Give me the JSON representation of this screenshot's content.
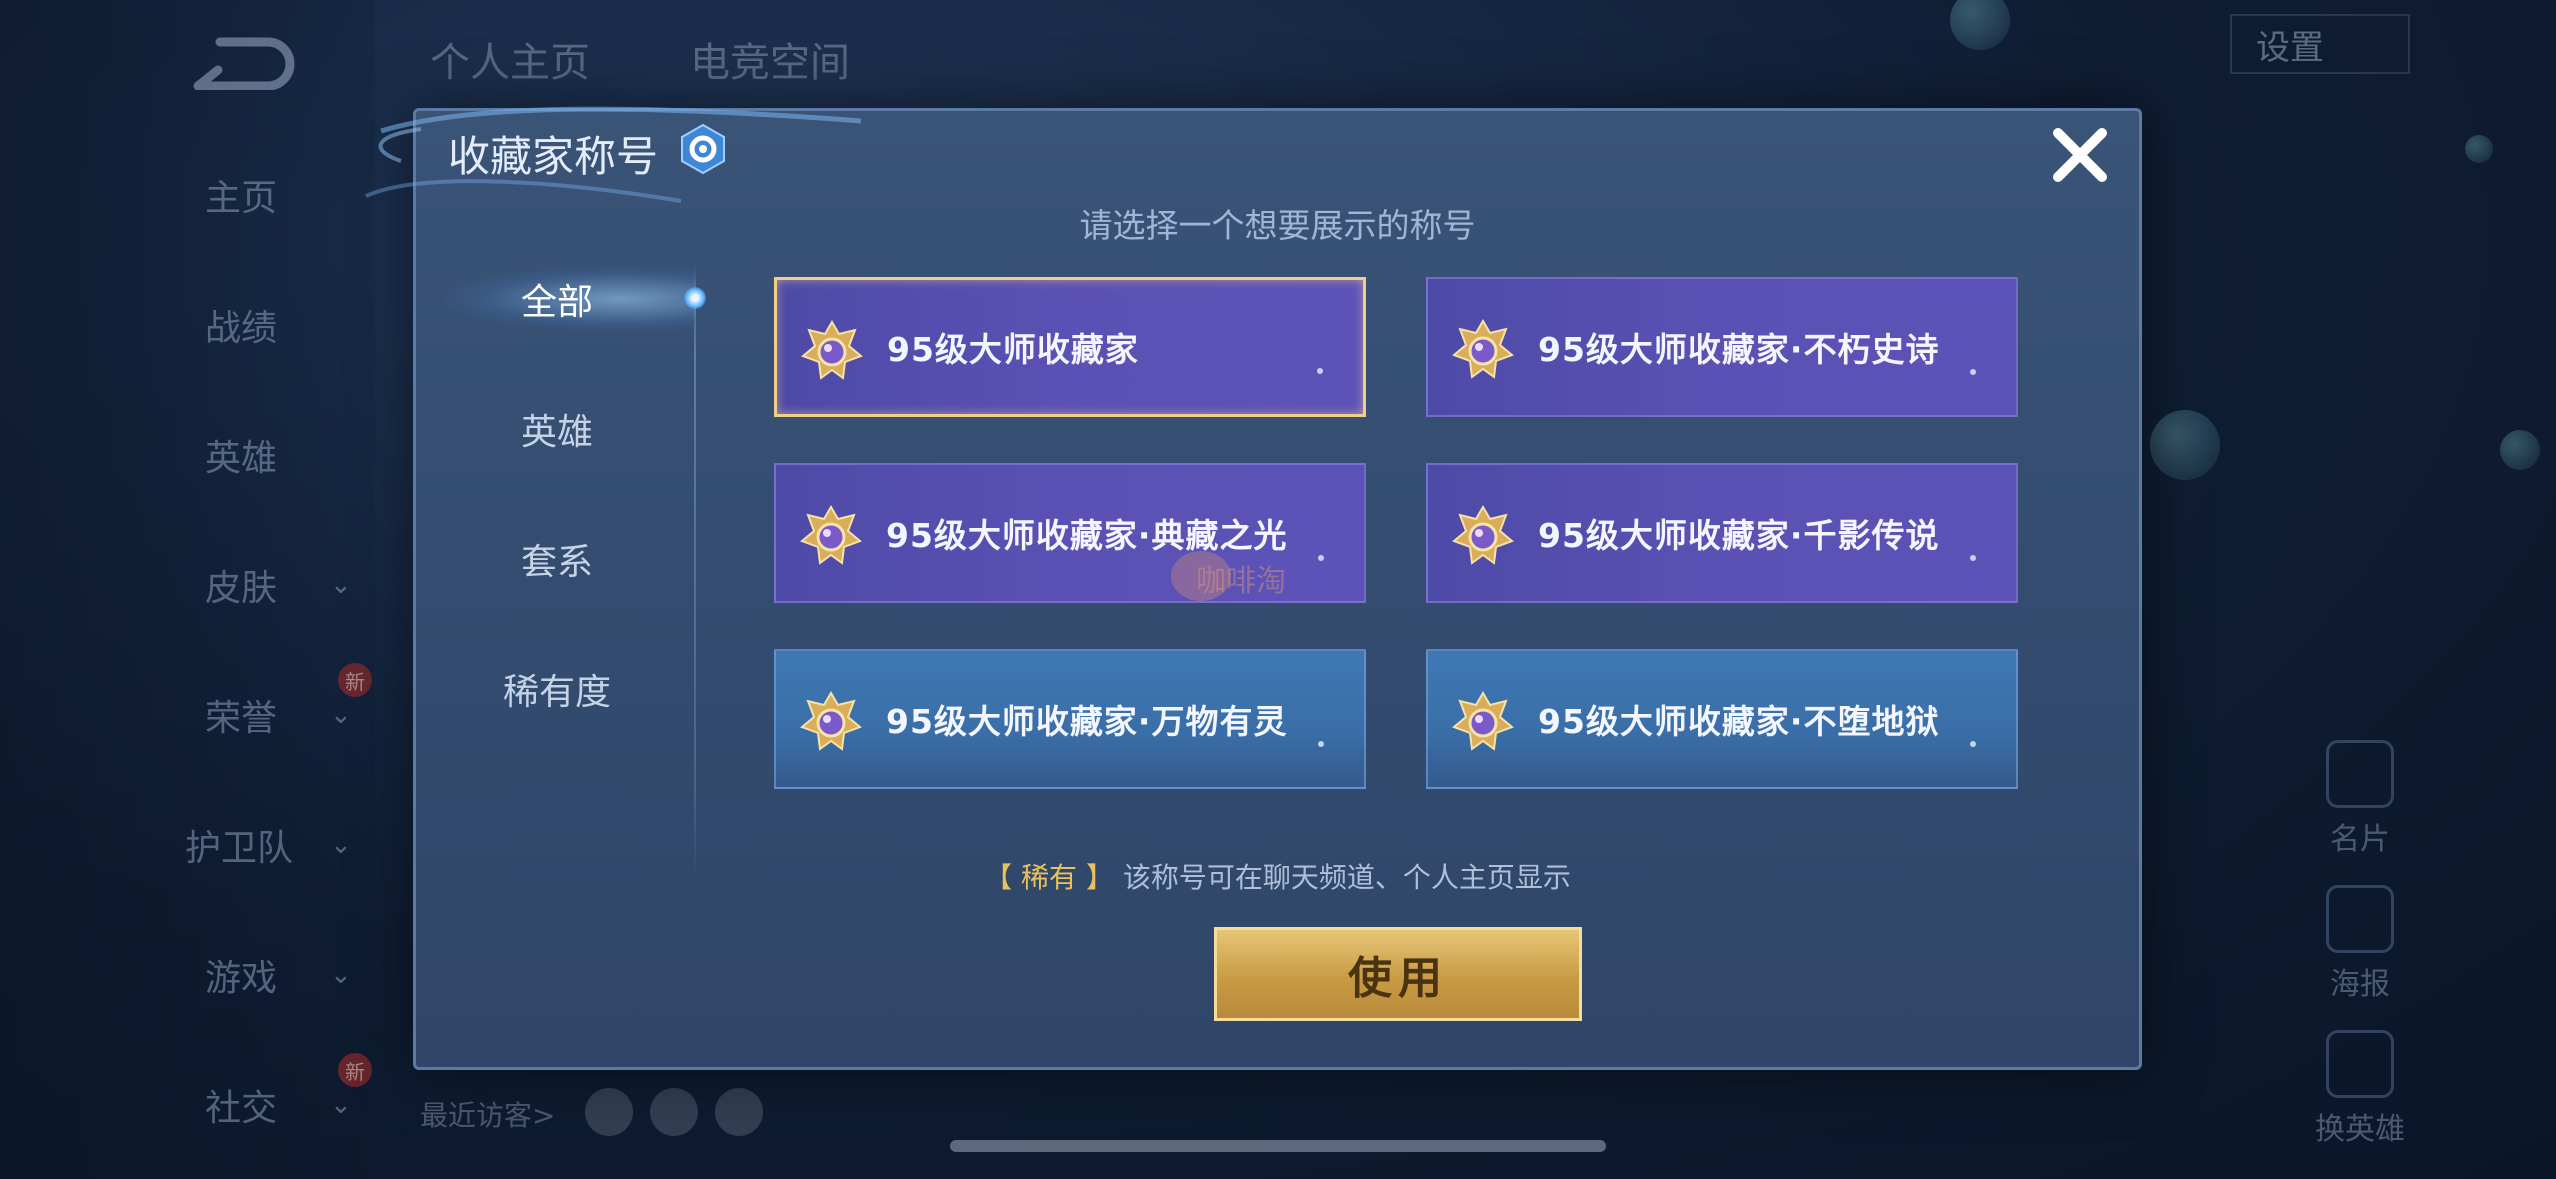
{
  "background": {
    "top_tabs": [
      "个人主页",
      "电竞空间"
    ],
    "settings_label": "设置",
    "sidebar": [
      {
        "label": "主页",
        "chevron": false,
        "new": false
      },
      {
        "label": "战绩",
        "chevron": false,
        "new": false
      },
      {
        "label": "英雄",
        "chevron": false,
        "new": false
      },
      {
        "label": "皮肤",
        "chevron": true,
        "new": false
      },
      {
        "label": "荣誉",
        "chevron": true,
        "new": true
      },
      {
        "label": "护卫队",
        "chevron": true,
        "new": false
      },
      {
        "label": "游戏",
        "chevron": true,
        "new": false
      },
      {
        "label": "社交",
        "chevron": true,
        "new": true
      }
    ],
    "new_badge": "新",
    "chevron_icon": "⌄",
    "recent_visitors_label": "最近访客>",
    "right_items": [
      "名片",
      "海报",
      "换英雄"
    ]
  },
  "modal": {
    "title": "收藏家称号",
    "subtitle": "请选择一个想要展示的称号",
    "close_icon": "close-icon",
    "categories": [
      {
        "label": "全部",
        "active": true
      },
      {
        "label": "英雄",
        "active": false
      },
      {
        "label": "套系",
        "active": false
      },
      {
        "label": "稀有度",
        "active": false
      }
    ],
    "titles": [
      {
        "label": "95级大师收藏家",
        "style": "purple",
        "selected": true
      },
      {
        "label": "95级大师收藏家·不朽史诗",
        "style": "purple",
        "selected": false
      },
      {
        "label": "95级大师收藏家·典藏之光",
        "style": "purple",
        "selected": false
      },
      {
        "label": "95级大师收藏家·千影传说",
        "style": "purple",
        "selected": false
      },
      {
        "label": "95级大师收藏家·万物有灵",
        "style": "blue",
        "selected": false
      },
      {
        "label": "95级大师收藏家·不堕地狱",
        "style": "blue",
        "selected": false
      }
    ],
    "rarity_tag": "【 稀有 】",
    "rarity_text": "该称号可在聊天频道、个人主页显示",
    "use_button": "使用",
    "watermark": "咖啡淘"
  },
  "colors": {
    "accent_gold": "#e8c15e",
    "card_purple": "#5a50b2",
    "card_blue": "#3d74af",
    "modal_bg": "#354f73"
  }
}
